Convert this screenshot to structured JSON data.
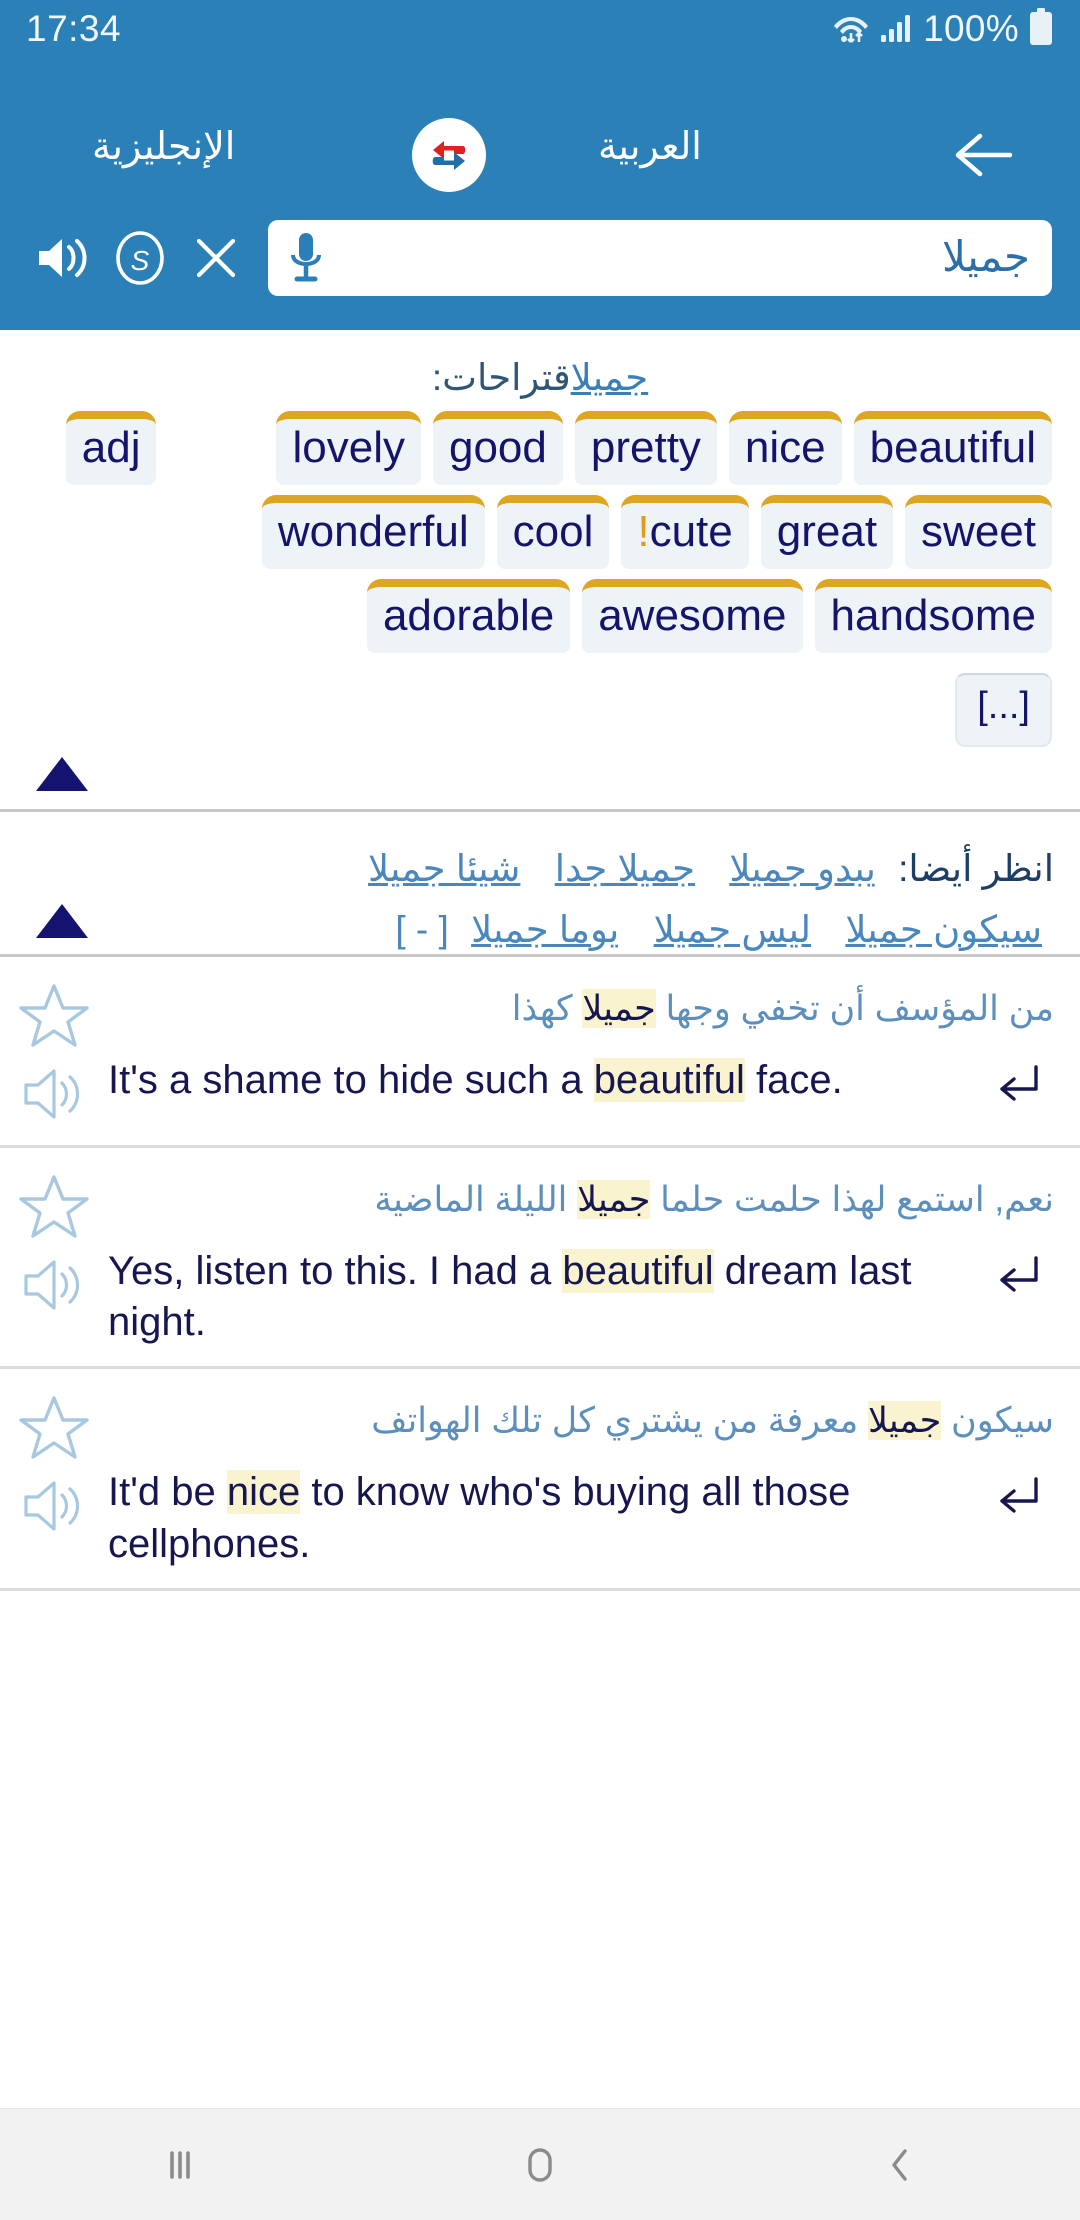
{
  "status_bar": {
    "time": "17:34",
    "battery_percent": "100%",
    "icons": [
      "wifi-icon",
      "signal-icon",
      "battery-icon"
    ]
  },
  "header": {
    "source_language": "الإنجليزية",
    "target_language": "العربية",
    "logo_icon": "reverso-swap-arrows-icon",
    "back_icon": "arrow-left-icon",
    "bg_color": "#2b80b8"
  },
  "search": {
    "value": "جميلا",
    "mic_icon": "microphone-icon",
    "speaker_icon": "speaker-icon",
    "spell_icon": "spellcheck-s-icon",
    "clear_icon": "close-x-icon"
  },
  "suggestions": {
    "label": "اقتراحات:",
    "keyword": "جميل",
    "pos_tag": "adj",
    "rows": [
      [
        "lovely",
        "good",
        "pretty",
        "nice",
        "beautiful"
      ],
      [
        "wonderful",
        "cool",
        "cute",
        "great",
        "sweet"
      ],
      [
        "adorable",
        "awesome",
        "handsome"
      ]
    ],
    "flagged_word": "cute",
    "flag_marker": "!",
    "more_label": "[...]",
    "collapse_icon": "triangle-up-icon",
    "chip_accent_color": "#dda520",
    "chip_bg_color": "#eef3f8",
    "chip_text_color": "#14146b"
  },
  "see_also": {
    "label": "انظر أيضا:",
    "links_line1": [
      "شيئا جميلا",
      "جميلا جدا",
      "يبدو جميلا"
    ],
    "links_line2": [
      "يوما جميلا",
      "ليس جميلا",
      "سيكون جميلا"
    ],
    "brackets": "[ - ]",
    "collapse_icon": "triangle-up-icon"
  },
  "examples": [
    {
      "arabic_before": "من المؤسف أن تخفي وجها ",
      "arabic_highlight": "جميلا",
      "arabic_after": " كهذا",
      "english_before": "It's a shame to hide such a ",
      "english_highlight": "beautiful",
      "english_after": " face.",
      "star_icon": "star-outline-icon",
      "speaker_icon": "speaker-outline-icon",
      "return_icon": "return-arrow-icon"
    },
    {
      "arabic_before": "نعم, استمع لهذا حلمت حلما ",
      "arabic_highlight": "جميلا",
      "arabic_after": " الليلة الماضية",
      "english_before": "Yes, listen to this. I had a ",
      "english_highlight": "beautiful",
      "english_after": " dream last night.",
      "star_icon": "star-outline-icon",
      "speaker_icon": "speaker-outline-icon",
      "return_icon": "return-arrow-icon"
    },
    {
      "arabic_before": "سيكون ",
      "arabic_highlight": "جميلا",
      "arabic_after": " معرفة من يشتري كل تلك الهواتف",
      "english_before": "It'd be ",
      "english_highlight": "nice",
      "english_after": " to know who's buying all those cellphones.",
      "star_icon": "star-outline-icon",
      "speaker_icon": "speaker-outline-icon",
      "return_icon": "return-arrow-icon"
    }
  ],
  "nav_bar": {
    "recents_icon": "recents-bars-icon",
    "home_icon": "home-circle-icon",
    "back_icon": "back-chevron-icon"
  }
}
